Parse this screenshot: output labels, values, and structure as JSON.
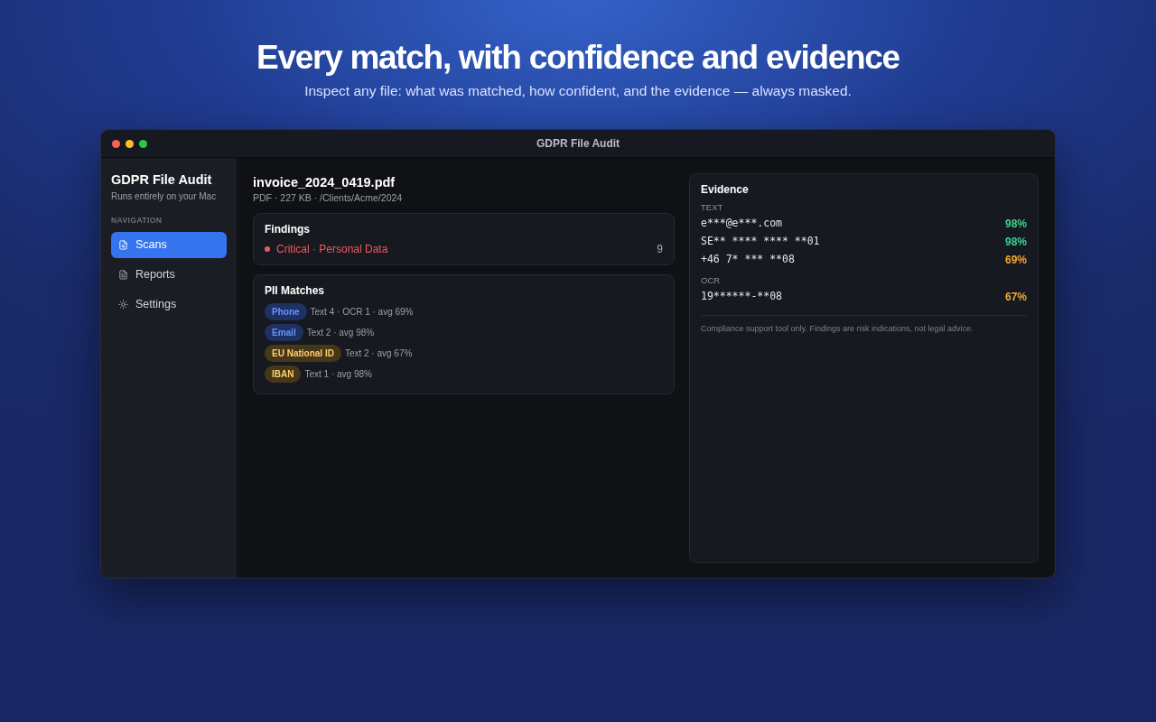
{
  "hero": {
    "title": "Every match, with confidence and evidence",
    "subtitle": "Inspect any file: what was matched, how confident, and the evidence — always masked."
  },
  "window": {
    "title": "GDPR File Audit"
  },
  "sidebar": {
    "title": "GDPR File Audit",
    "subtitle": "Runs entirely on your Mac",
    "section": "NAVIGATION",
    "items": [
      {
        "label": "Scans",
        "selected": true
      },
      {
        "label": "Reports",
        "selected": false
      },
      {
        "label": "Settings",
        "selected": false
      }
    ]
  },
  "file": {
    "name": "invoice_2024_0419.pdf",
    "meta": "PDF · 227 KB · /Clients/Acme/2024"
  },
  "findings": {
    "title": "Findings",
    "items": [
      {
        "label": "Critical · Personal Data",
        "count": "9",
        "color": "#f25a5a"
      }
    ]
  },
  "pii_matches": {
    "title": "PII Matches",
    "items": [
      {
        "tag": "Phone",
        "detail": "Text 4 · OCR 1 · avg 69%",
        "color": "#1f3160"
      },
      {
        "tag": "Email",
        "detail": "Text 2 · avg 98%",
        "color": "#1f3160"
      },
      {
        "tag": "EU National ID",
        "detail": "Text 2 · avg 67%",
        "color": "#463718"
      },
      {
        "tag": "IBAN",
        "detail": "Text 1 · avg 98%",
        "color": "#463718"
      }
    ]
  },
  "evidence": {
    "title": "Evidence",
    "groups": [
      {
        "label": "TEXT",
        "rows": [
          {
            "value": "e***@e***.com",
            "confidence": "98%",
            "color": "#3fcf8e"
          },
          {
            "value": "SE** **** **** **01",
            "confidence": "98%",
            "color": "#3fcf8e"
          },
          {
            "value": "+46 7* *** **08",
            "confidence": "69%",
            "color": "#f0a830"
          }
        ]
      },
      {
        "label": "OCR",
        "rows": [
          {
            "value": "19******-**08",
            "confidence": "67%",
            "color": "#f0a830"
          }
        ]
      }
    ],
    "note": "Compliance support tool only. Findings are risk indications, not legal advice."
  }
}
